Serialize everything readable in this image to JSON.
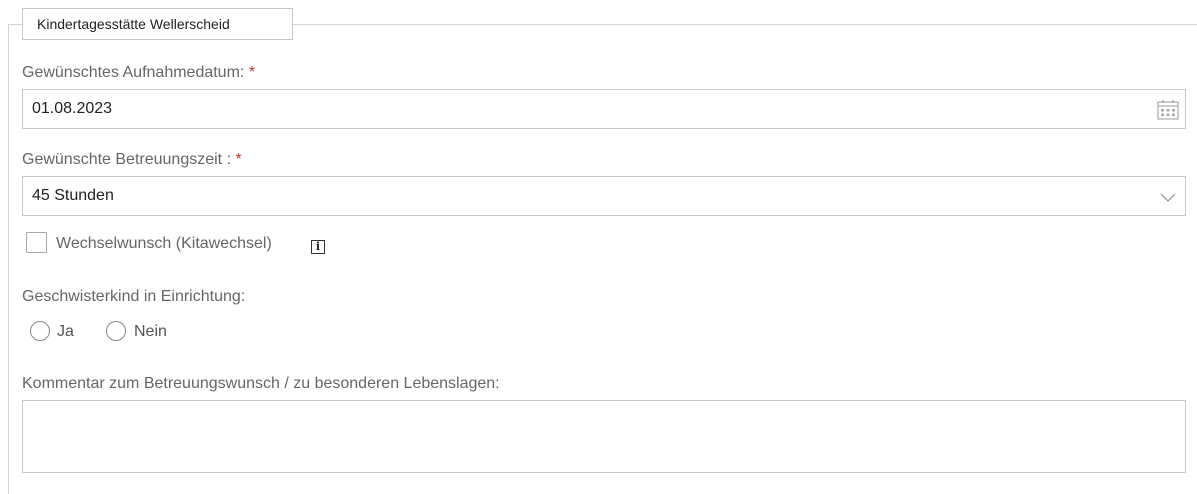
{
  "fieldset": {
    "legend": "Kindertagesstätte Wellerscheid"
  },
  "admission_date": {
    "label": "Gewünschtes Aufnahmedatum:",
    "required_mark": "*",
    "value": "01.08.2023",
    "icon": "calendar-icon"
  },
  "care_time": {
    "label": "Gewünschte Betreuungszeit :",
    "required_mark": "*",
    "selected": "45 Stunden",
    "icon": "chevron-down-icon"
  },
  "change_wish": {
    "label": "Wechselwunsch (Kitawechsel)",
    "checked": false,
    "info_glyph": "i",
    "icon": "info-icon"
  },
  "sibling": {
    "label": "Geschwisterkind in Einrichtung:",
    "options": [
      "Ja",
      "Nein"
    ]
  },
  "comment": {
    "label": "Kommentar zum Betreuungswunsch / zu besonderen Lebenslagen:",
    "value": ""
  },
  "colors": {
    "required": "#c0392b",
    "border": "#c8c8c8",
    "label": "#666666"
  }
}
